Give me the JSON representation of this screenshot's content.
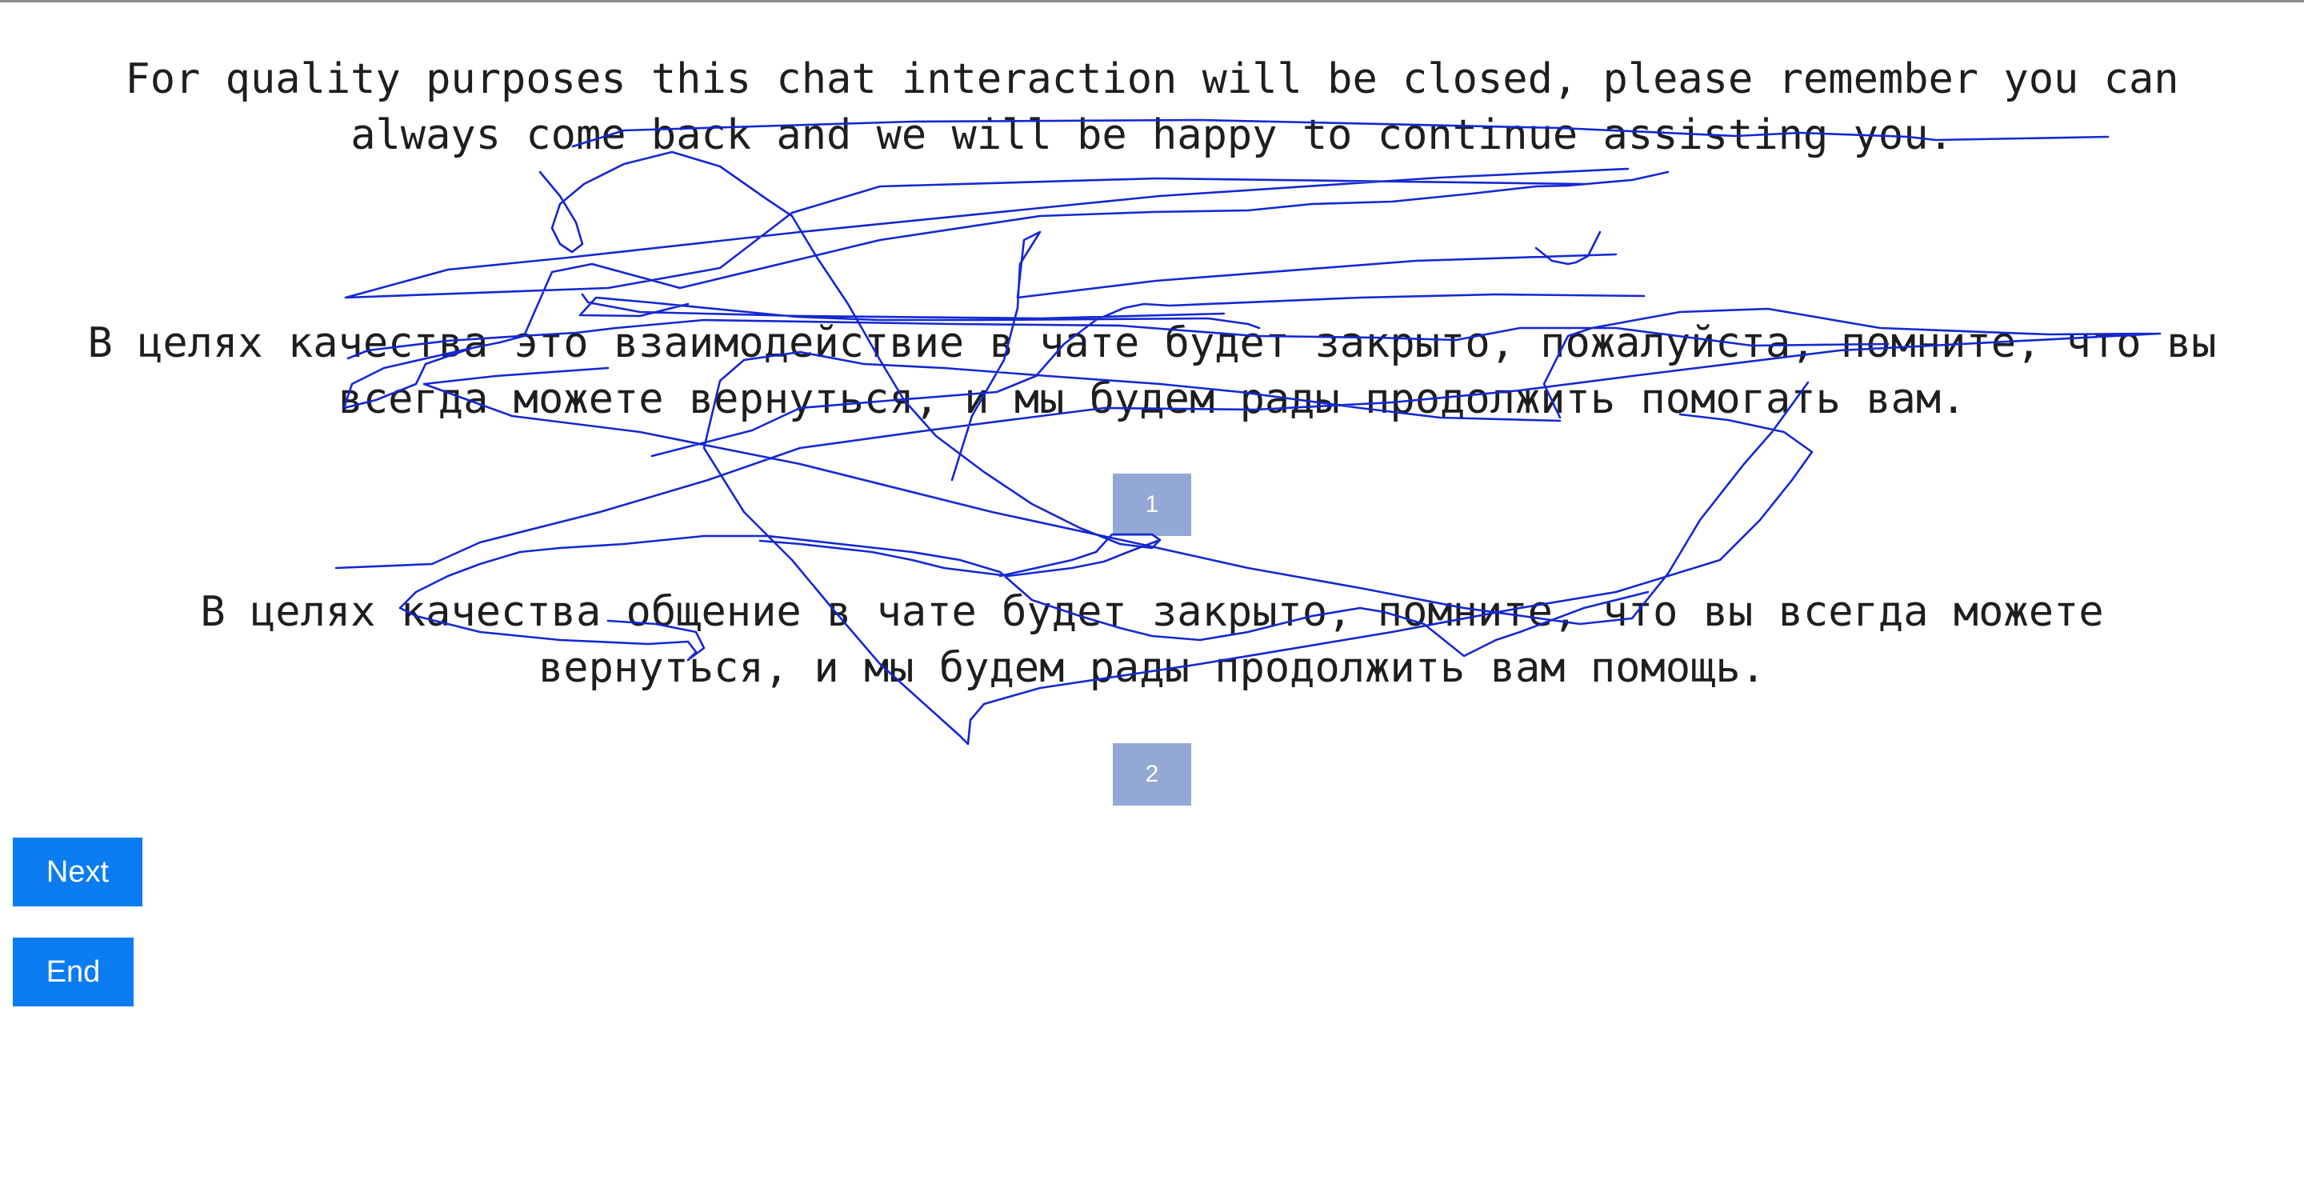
{
  "passages": [
    {
      "lines": [
        "For quality purposes this chat interaction will be closed, please remember you can",
        "always come back and we will be happy to continue assisting you."
      ]
    },
    {
      "lines": [
        "В целях качества это взаимодействие в чате будет закрыто, пожалуйста, помните, что вы",
        "всегда можете вернуться, и мы будем рады продолжить помогать вам."
      ]
    },
    {
      "lines": [
        "В целях качества общение в чате будет закрыто, помните, что вы всегда можете",
        "вернуться, и мы будем рады продолжить вам помощь."
      ]
    }
  ],
  "markers": [
    "1",
    "2"
  ],
  "buttons": {
    "next_label": "Next",
    "end_label": "End"
  },
  "colors": {
    "scribble": "#1428d2",
    "marker_bg": "#93a8d4",
    "button_bg": "#0b7cf2",
    "text": "#1e1e1e"
  }
}
